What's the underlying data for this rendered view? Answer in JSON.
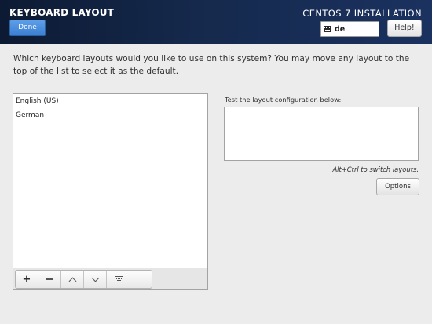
{
  "header": {
    "spoke_title": "KEYBOARD LAYOUT",
    "done_label": "Done",
    "install_title": "CENTOS 7 INSTALLATION",
    "keyboard_indicator": "de",
    "help_label": "Help!"
  },
  "instructions": "Which keyboard layouts would you like to use on this system?  You may move any layout to the top of the list to select it as the default.",
  "layouts": {
    "items": [
      {
        "label": "English (US)"
      },
      {
        "label": "German"
      }
    ],
    "toolbar": {
      "add_icon": "plus-icon",
      "remove_icon": "minus-icon",
      "up_icon": "chevron-up-icon",
      "down_icon": "chevron-down-icon",
      "preview_icon": "keyboard-icon"
    }
  },
  "test": {
    "label": "Test the layout configuration below:",
    "value": "",
    "switch_hint": "Alt+Ctrl to switch layouts.",
    "options_label": "Options"
  },
  "colors": {
    "header_bg": "#15294c",
    "done_button": "#4a8fe0",
    "page_bg": "#ececec"
  }
}
